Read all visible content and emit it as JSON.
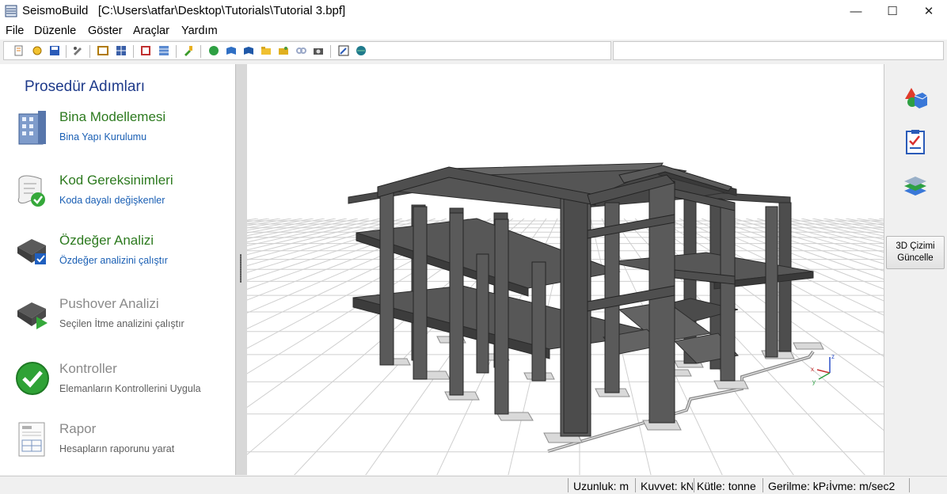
{
  "window": {
    "app_name": "SeismoBuild",
    "file_path": "[C:\\Users\\atfar\\Desktop\\Tutorials\\Tutorial 3.bpf]",
    "minimize_glyph": "—",
    "maximize_glyph": "☐",
    "close_glyph": "✕"
  },
  "menu": [
    "File",
    "Düzenle",
    "Göster",
    "Araçlar",
    "Yardım"
  ],
  "left_panel": {
    "title": "Prosedür Adımları",
    "steps": [
      {
        "title": "Bina Modellemesi",
        "subtitle": "Bina Yapı Kurulumu",
        "icon": "building-icon",
        "enabled": true
      },
      {
        "title": "Kod Gereksinimleri",
        "subtitle": "Koda dayalı değişkenler",
        "icon": "code-requirements-icon",
        "enabled": true
      },
      {
        "title": "Özdeğer Analizi",
        "subtitle": "Özdeğer analizini çalıştır",
        "icon": "eigenvalue-analysis-icon",
        "enabled": true
      },
      {
        "title": "Pushover Analizi",
        "subtitle": "Seçilen İtme analizini çalıştır",
        "icon": "pushover-analysis-icon",
        "enabled": false
      },
      {
        "title": "Kontroller",
        "subtitle": "Elemanların Kontrollerini Uygula",
        "icon": "checkmark-icon",
        "enabled": false
      },
      {
        "title": "Rapor",
        "subtitle": "Hesapların raporunu yarat",
        "icon": "report-icon",
        "enabled": false
      }
    ]
  },
  "right_panel": {
    "icons": [
      "shapes-icon",
      "checklist-icon",
      "layers-icon"
    ],
    "update_button": {
      "line1": "3D Çizimi",
      "line2": "Güncelle"
    }
  },
  "axes": {
    "x": "x",
    "y": "y",
    "z": "z"
  },
  "status_bar": {
    "length": "Uzunluk: m",
    "force": "Kuvvet: kN",
    "mass": "Kütle: tonne",
    "stress": "Gerilme: kPa",
    "acceleration": "İvme: m/sec2"
  }
}
